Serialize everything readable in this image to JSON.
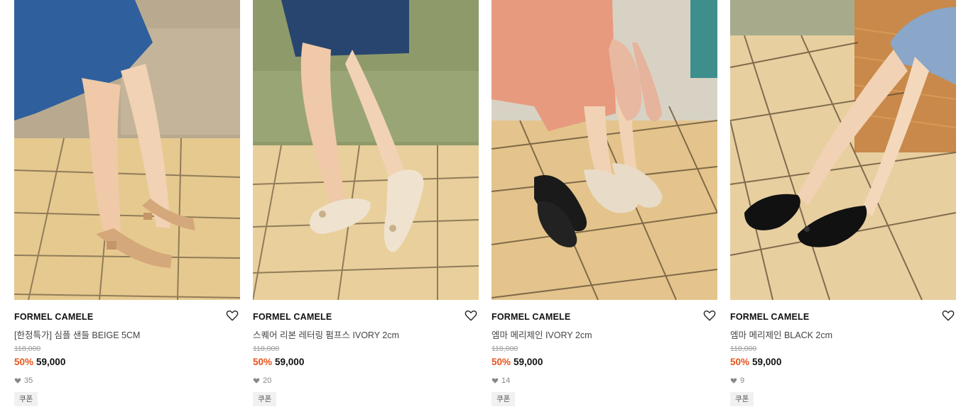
{
  "products": [
    {
      "brand": "FORMEL CAMELE",
      "name": "[한정특가] 심플 샌들 BEIGE 5CM",
      "original_price": "118,000",
      "discount": "50%",
      "price": "59,000",
      "likes": "35",
      "badge": "쿠폰",
      "image": {
        "floor": "#e6c98f",
        "wall": "#b9aa8f",
        "skirt": "#2f5f9c",
        "shoe": "#d4a87a"
      }
    },
    {
      "brand": "FORMEL CAMELE",
      "name": "스퀘어 리본 레터링 펌프스 IVORY 2cm",
      "original_price": "118,000",
      "discount": "50%",
      "price": "59,000",
      "likes": "20",
      "badge": "쿠폰",
      "image": {
        "floor": "#e9cf9b",
        "wall": "#8f9a6a",
        "skirt": "#27456e",
        "shoe": "#efe3cf"
      }
    },
    {
      "brand": "FORMEL CAMELE",
      "name": "엠마 메리제인 IVORY 2cm",
      "original_price": "118,000",
      "discount": "50%",
      "price": "59,000",
      "likes": "14",
      "badge": "쿠폰",
      "image": {
        "floor": "#e4c48c",
        "wall": "#d8d2c4",
        "skirt": "#e79a7d",
        "shoe": "#1a1a1a"
      }
    },
    {
      "brand": "FORMEL CAMELE",
      "name": "엠마 메리제인 BLACK 2cm",
      "original_price": "118,000",
      "discount": "50%",
      "price": "59,000",
      "likes": "9",
      "badge": "쿠폰",
      "image": {
        "floor": "#e8cfa0",
        "wall": "#a7ab8c",
        "skirt": "#8aa6c8",
        "shoe": "#111111"
      }
    }
  ],
  "colors": {
    "discount": "#e8541c",
    "text": "#111111",
    "muted": "#9a9a9a"
  },
  "icons": {
    "wishlist": "heart-outline-icon",
    "likes": "heart-filled-icon"
  }
}
